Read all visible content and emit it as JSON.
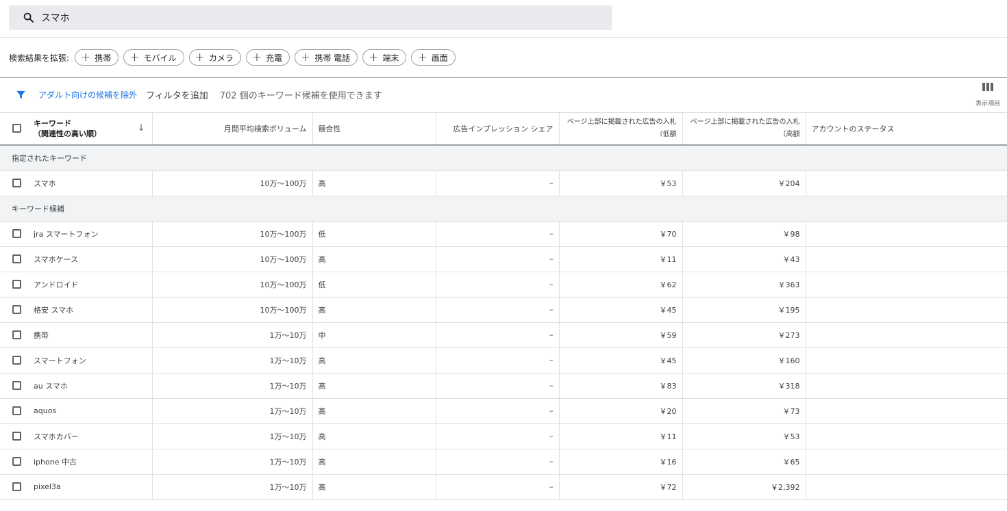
{
  "search": {
    "query": "スマホ"
  },
  "expand": {
    "label": "検索結果を拡張:",
    "chips": [
      "携帯",
      "モバイル",
      "カメラ",
      "充電",
      "携帯 電話",
      "端末",
      "画面"
    ]
  },
  "filter": {
    "adult_link": "アダルト向けの候補を除外",
    "add_filter": "フィルタを追加",
    "count_text": "702 個のキーワード候補を使用できます"
  },
  "columns_button": {
    "label": "表示項目"
  },
  "table": {
    "headers": {
      "keyword_line1": "キーワード",
      "keyword_line2": "（関連性の高い順）",
      "volume": "月間平均検索ボリューム",
      "competition": "競合性",
      "impression_share": "広告インプレッション シェア",
      "bid_low_line1": "ページ上部に掲載された広告の入札",
      "bid_low_line2": "（低額",
      "bid_high_line1": "ページ上部に掲載された広告の入札",
      "bid_high_line2": "（高額",
      "status": "アカウントのステータス"
    },
    "group_specified": "指定されたキーワード",
    "specified_rows": [
      {
        "keyword": "スマホ",
        "volume": "10万～100万",
        "competition": "高",
        "share": "–",
        "bid_low": "￥53",
        "bid_high": "￥204"
      }
    ],
    "group_ideas": "キーワード候補",
    "idea_rows": [
      {
        "keyword": "jra スマートフォン",
        "volume": "10万～100万",
        "competition": "低",
        "share": "–",
        "bid_low": "￥70",
        "bid_high": "￥98"
      },
      {
        "keyword": "スマホケース",
        "volume": "10万～100万",
        "competition": "高",
        "share": "–",
        "bid_low": "￥11",
        "bid_high": "￥43"
      },
      {
        "keyword": "アンドロイド",
        "volume": "10万～100万",
        "competition": "低",
        "share": "–",
        "bid_low": "￥62",
        "bid_high": "￥363"
      },
      {
        "keyword": "格安 スマホ",
        "volume": "10万～100万",
        "competition": "高",
        "share": "–",
        "bid_low": "￥45",
        "bid_high": "￥195"
      },
      {
        "keyword": "携帯",
        "volume": "1万～10万",
        "competition": "中",
        "share": "–",
        "bid_low": "￥59",
        "bid_high": "￥273"
      },
      {
        "keyword": "スマートフォン",
        "volume": "1万～10万",
        "competition": "高",
        "share": "–",
        "bid_low": "￥45",
        "bid_high": "￥160"
      },
      {
        "keyword": "au スマホ",
        "volume": "1万～10万",
        "competition": "高",
        "share": "–",
        "bid_low": "￥83",
        "bid_high": "￥318"
      },
      {
        "keyword": "aquos",
        "volume": "1万～10万",
        "competition": "高",
        "share": "–",
        "bid_low": "￥20",
        "bid_high": "￥73"
      },
      {
        "keyword": "スマホカバー",
        "volume": "1万～10万",
        "competition": "高",
        "share": "–",
        "bid_low": "￥11",
        "bid_high": "￥53"
      },
      {
        "keyword": "iphone 中古",
        "volume": "1万～10万",
        "competition": "高",
        "share": "–",
        "bid_low": "￥16",
        "bid_high": "￥65"
      },
      {
        "keyword": "pixel3a",
        "volume": "1万～10万",
        "competition": "高",
        "share": "–",
        "bid_low": "￥72",
        "bid_high": "￥2,392"
      }
    ]
  },
  "colors": {
    "accent": "#1a73e8",
    "search_bg": "#e8eaed",
    "group_bg": "#f1f3f4"
  },
  "icons": {
    "search": "search-icon",
    "filter": "filter-icon",
    "columns": "columns-icon",
    "sort": "arrow-down-icon"
  }
}
